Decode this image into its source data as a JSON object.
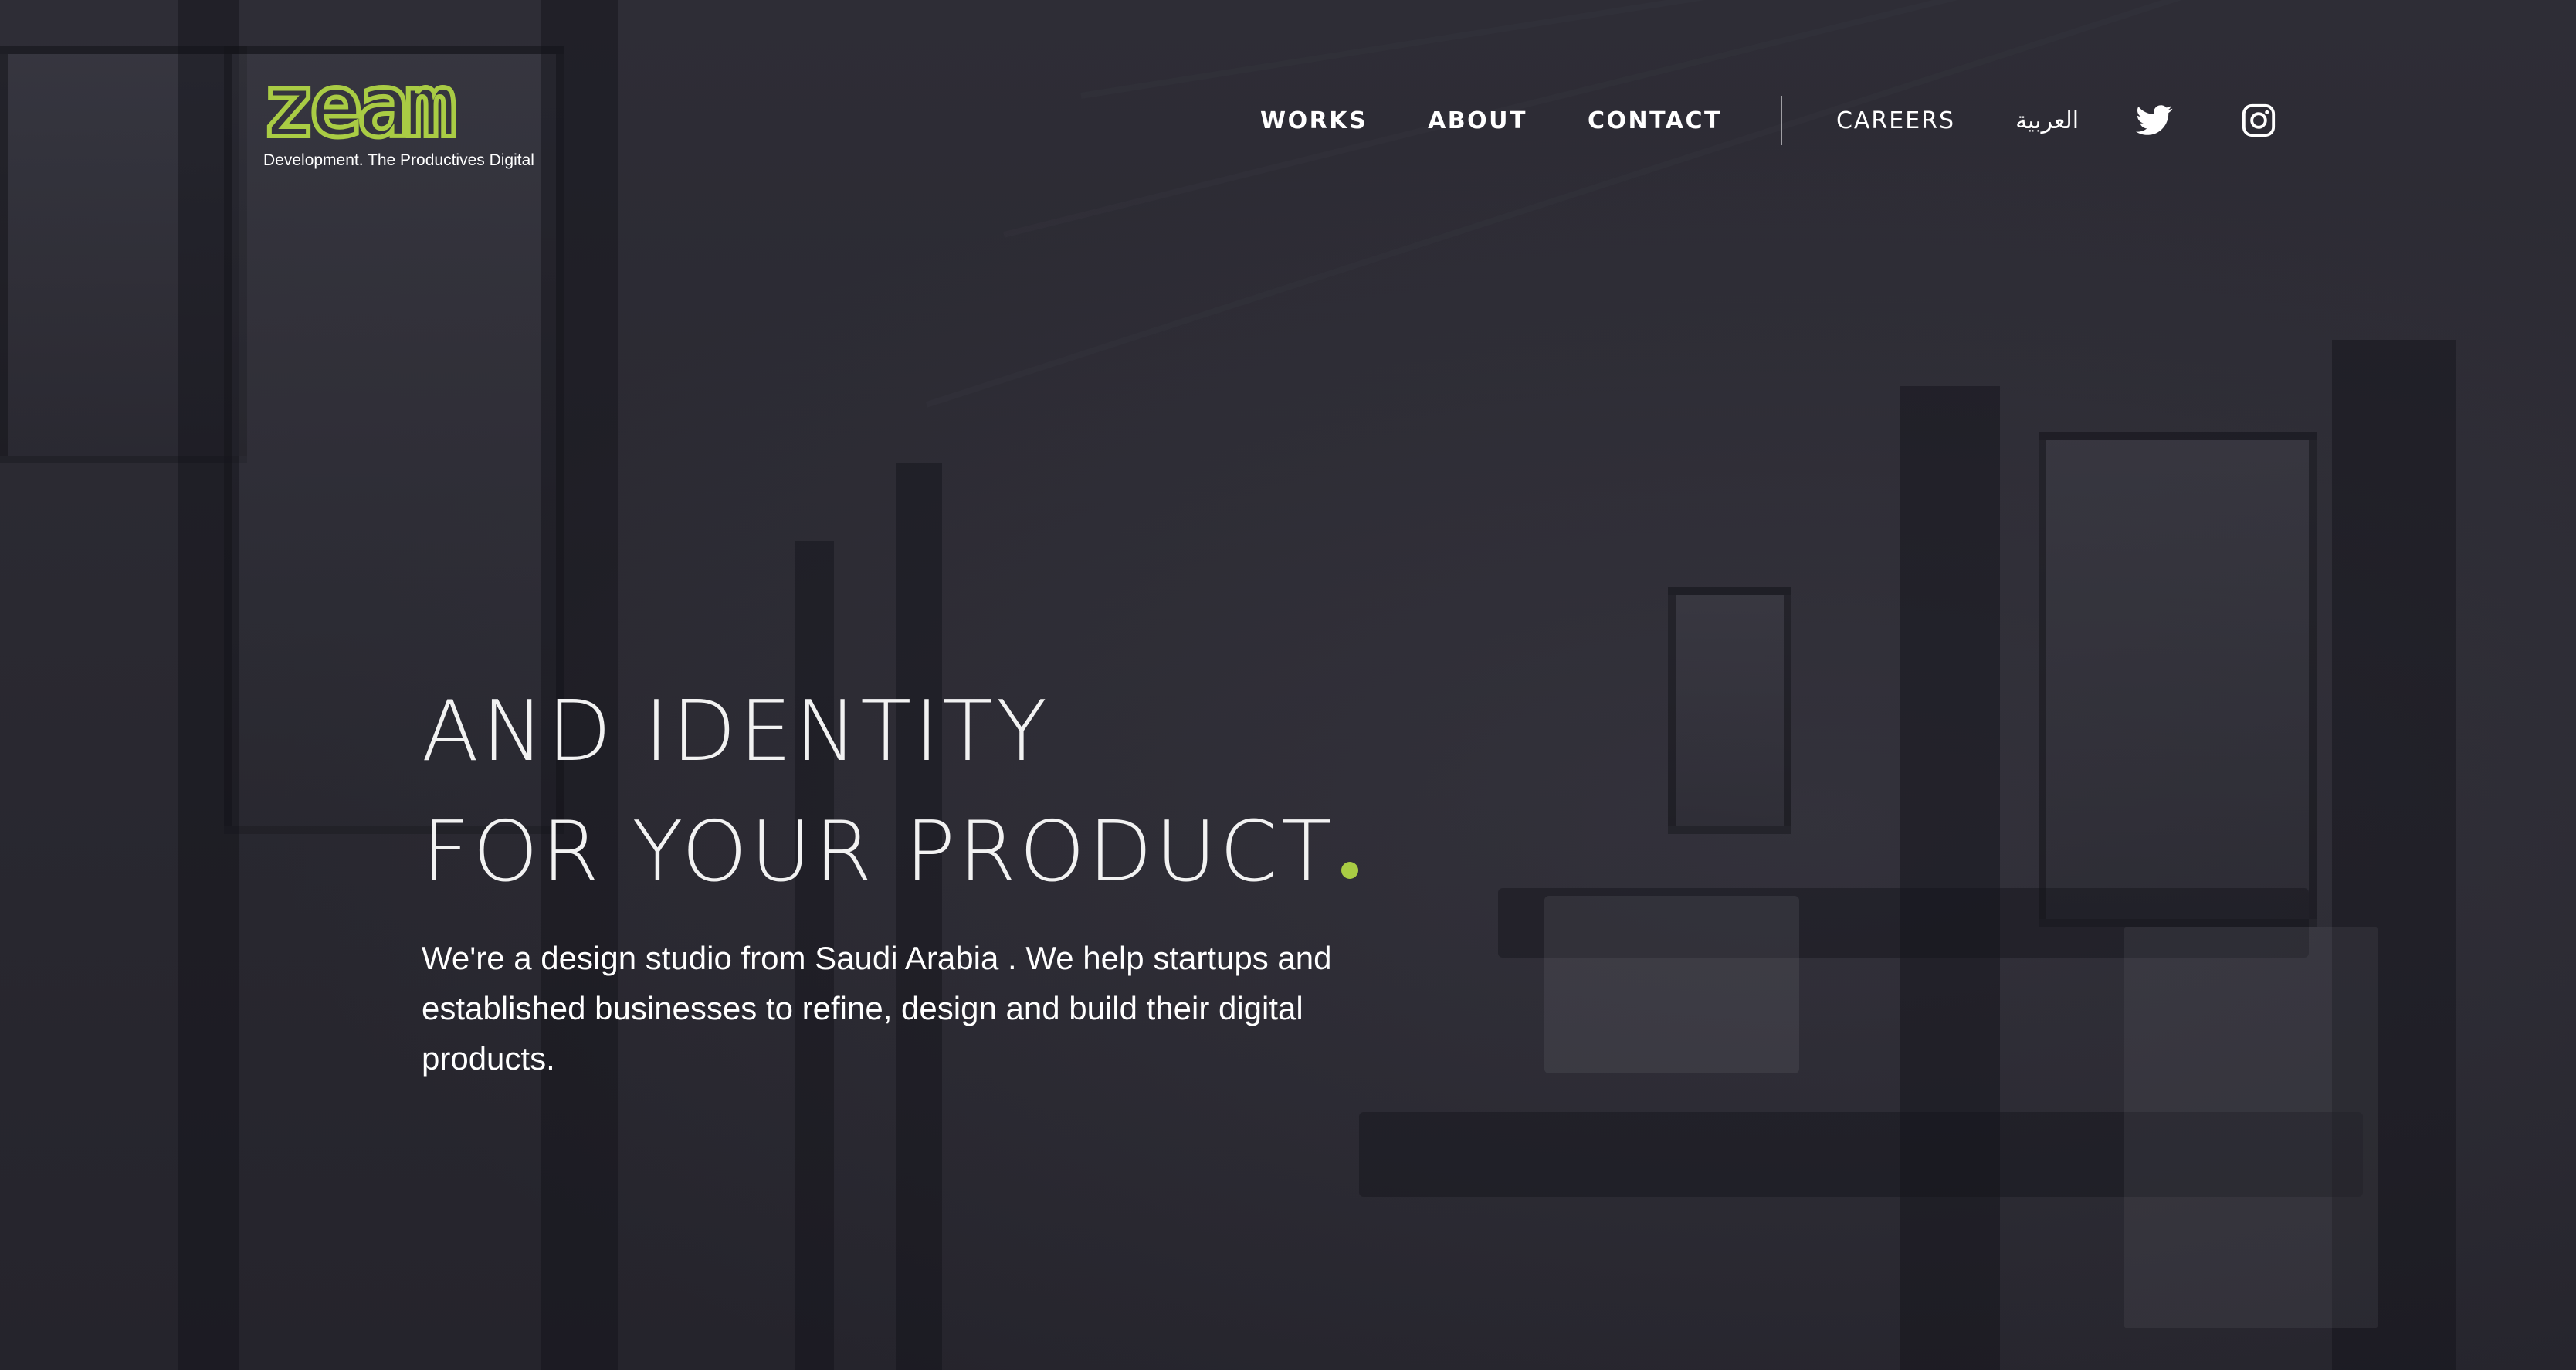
{
  "brand": {
    "logo_word": "zeam",
    "tagline": "Development. The Productives Digital",
    "accent_color": "#a9cc44"
  },
  "nav": {
    "works": "WORKS",
    "about": "ABOUT",
    "contact": "CONTACT",
    "careers": "CAREERS",
    "language": "العربية",
    "social": [
      "twitter-icon",
      "instagram-icon"
    ]
  },
  "hero": {
    "line1": "AND IDENTITY",
    "line2": "FOR YOUR PRODUCT",
    "description": "We're a design studio from Saudi Arabia . We help startups and established businesses to refine, design and build their digital products."
  }
}
